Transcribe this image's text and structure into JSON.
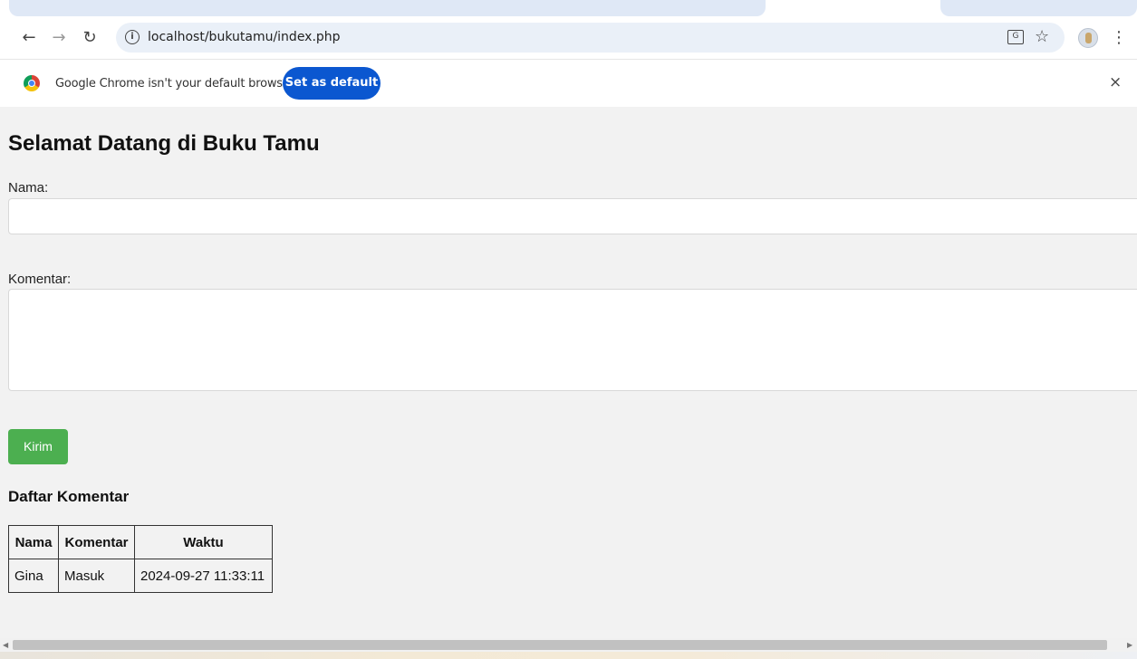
{
  "browser": {
    "url": "localhost/bukutamu/index.php",
    "icons": {
      "back": "back-arrow-icon",
      "forward": "forward-arrow-icon",
      "reload": "reload-icon",
      "site_info": "info-icon",
      "translate": "translate-icon",
      "bookmark": "star-icon",
      "profile": "avatar",
      "menu": "kebab-menu-icon"
    }
  },
  "infobar": {
    "message": "Google Chrome isn't your default browser",
    "button_label": "Set as default",
    "close_label": "×"
  },
  "page": {
    "title": "Selamat Datang di Buku Tamu",
    "form": {
      "nama_label": "Nama:",
      "nama_value": "",
      "komentar_label": "Komentar:",
      "komentar_value": "",
      "submit_label": "Kirim"
    },
    "list_title": "Daftar Komentar",
    "table": {
      "headers": [
        "Nama",
        "Komentar",
        "Waktu"
      ],
      "rows": [
        [
          "Gina",
          "Masuk",
          "2024-09-27 11:33:11"
        ]
      ]
    }
  },
  "colors": {
    "accent_button": "#4caf50",
    "chrome_blue": "#0b57d0",
    "page_bg": "#f2f2f2"
  }
}
